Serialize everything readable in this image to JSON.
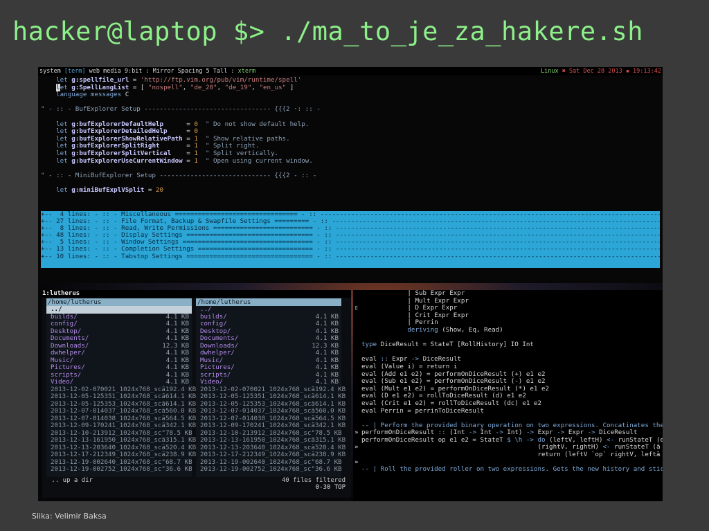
{
  "slide": {
    "title": "hacker@laptop $> ./ma_to_je_za_hakere.sh",
    "caption": "Slika: Velimir Baksa"
  },
  "statusbar": {
    "left_prefix": "system ",
    "left_tag": "[term]",
    "left_rest": " web media 9:bit : Mirror Spacing 5 Tall : ",
    "left_app": "xterm",
    "right_os": "Linux",
    "right_date": " ✖ Sat Dec 28 2013 ▪ 19:13:42"
  },
  "vim": {
    "lines": [
      [
        {
          "t": "    "
        },
        {
          "t": "let ",
          "c": "kw"
        },
        {
          "t": "g:spellfile_url",
          "c": "var"
        },
        {
          "t": " = "
        },
        {
          "t": "'http://ftp.vim.org/pub/vim/runtime/spell'",
          "c": "str"
        }
      ],
      [
        {
          "t": "    "
        },
        {
          "t": "l",
          "c": "cursor"
        },
        {
          "t": "et ",
          "c": "kw"
        },
        {
          "t": "g:SpellLangList",
          "c": "var"
        },
        {
          "t": " = [ "
        },
        {
          "t": "\"nospell\"",
          "c": "str"
        },
        {
          "t": ", "
        },
        {
          "t": "\"de_20\"",
          "c": "str"
        },
        {
          "t": ", "
        },
        {
          "t": "\"de_19\"",
          "c": "str"
        },
        {
          "t": ", "
        },
        {
          "t": "\"en_us\"",
          "c": "str"
        },
        {
          "t": " ]"
        }
      ],
      [
        {
          "t": "    "
        },
        {
          "t": "language messages ",
          "c": "kw"
        },
        {
          "t": "C"
        }
      ],
      [
        {
          "t": ""
        }
      ],
      [
        {
          "t": "\" - :: - BufExplorer Setup --------------------------------- {{{2 ·: :: -",
          "c": "cmt"
        }
      ],
      [
        {
          "t": ""
        }
      ],
      [
        {
          "t": "    "
        },
        {
          "t": "let ",
          "c": "kw"
        },
        {
          "t": "g:bufExplorerDefaultHelp",
          "c": "var"
        },
        {
          "t": "      = "
        },
        {
          "t": "0",
          "c": "num"
        },
        {
          "t": "  \" Do not show default help.",
          "c": "cmt"
        }
      ],
      [
        {
          "t": "    "
        },
        {
          "t": "let ",
          "c": "kw"
        },
        {
          "t": "g:bufExplorerDetailedHelp",
          "c": "var"
        },
        {
          "t": "     = "
        },
        {
          "t": "0",
          "c": "num"
        }
      ],
      [
        {
          "t": "    "
        },
        {
          "t": "let ",
          "c": "kw"
        },
        {
          "t": "g:bufExplorerShowRelativePath",
          "c": "var"
        },
        {
          "t": " = "
        },
        {
          "t": "1",
          "c": "num"
        },
        {
          "t": "  \" Show relative paths.",
          "c": "cmt"
        }
      ],
      [
        {
          "t": "    "
        },
        {
          "t": "let ",
          "c": "kw"
        },
        {
          "t": "g:bufExplorerSplitRight",
          "c": "var"
        },
        {
          "t": "       = "
        },
        {
          "t": "1",
          "c": "num"
        },
        {
          "t": "  \" Split right.",
          "c": "cmt"
        }
      ],
      [
        {
          "t": "    "
        },
        {
          "t": "let ",
          "c": "kw"
        },
        {
          "t": "g:bufExplorerSplitVertical",
          "c": "var"
        },
        {
          "t": "    = "
        },
        {
          "t": "1",
          "c": "num"
        },
        {
          "t": "  \" Split vertically.",
          "c": "cmt"
        }
      ],
      [
        {
          "t": "    "
        },
        {
          "t": "let ",
          "c": "kw"
        },
        {
          "t": "g:bufExplorerUseCurrentWindow",
          "c": "var"
        },
        {
          "t": " = "
        },
        {
          "t": "1",
          "c": "num"
        },
        {
          "t": "  \" Open using current window.",
          "c": "cmt"
        }
      ],
      [
        {
          "t": ""
        }
      ],
      [
        {
          "t": "\" - :: - MiniBufExplorer Setup ----------------------------- {{{2 - :: -",
          "c": "cmt"
        }
      ],
      [
        {
          "t": ""
        }
      ],
      [
        {
          "t": "    "
        },
        {
          "t": "let ",
          "c": "kw"
        },
        {
          "t": "g:miniBufExplVSplit",
          "c": "var"
        },
        {
          "t": " = "
        },
        {
          "t": "20",
          "c": "num"
        }
      ]
    ],
    "folds": [
      "+--  4 lines: - :: - Miscellaneous ================================ - :: -----------------------------------------------------------------------------------------",
      "+-- 27 lines: - :: - File Format, Backup & Swapfile Settings ========= - :: -----------------------------------------------------------------------------------------",
      "+--  8 lines: - :: - Read, Write Permissions ========================== - :: -----------------------------------------------------------------------------------------",
      "+-- 48 lines: - :: - Display Settings ================================= - :: -----------------------------------------------------------------------------------------",
      "+--  5 lines: - :: - Window Settings ================================== - :: -----------------------------------------------------------------------------------------",
      "+-- 13 lines: - :: - Completion Settings ============================== - :: -----------------------------------------------------------------------------------------",
      "+-- 10 lines: - :: - Tabstop Settings ================================= - :: -----------------------------------------------------------------------------------------"
    ]
  },
  "filemanager": {
    "tab_label": "1:lutherus",
    "footer_left": " .. up a dir",
    "footer_right": "40 files filtered",
    "footer_pos": "0-30 TOP",
    "columns": [
      {
        "path": "/home/lutherus",
        "rows": [
          {
            "name": "../",
            "size": "",
            "kind": "sel"
          },
          {
            "name": "builds/",
            "size": "4.1 KB",
            "kind": "dir"
          },
          {
            "name": "config/",
            "size": "4.1 KB",
            "kind": "dir"
          },
          {
            "name": "Desktop/",
            "size": "4.1 KB",
            "kind": "dir"
          },
          {
            "name": "Documents/",
            "size": "4.1 KB",
            "kind": "dir"
          },
          {
            "name": "Downloads/",
            "size": "12.3 KB",
            "kind": "dir"
          },
          {
            "name": "dwhelper/",
            "size": "4.1 KB",
            "kind": "dir"
          },
          {
            "name": "Music/",
            "size": "4.1 KB",
            "kind": "dir"
          },
          {
            "name": "Pictures/",
            "size": "4.1 KB",
            "kind": "dir"
          },
          {
            "name": "scripts/",
            "size": "4.1 KB",
            "kind": "dir"
          },
          {
            "name": "Video/",
            "size": "4.1 KB",
            "kind": "dir"
          },
          {
            "name": "2013-12-02-070021_1024x768_scä",
            "size": "192.4 KB",
            "kind": "file"
          },
          {
            "name": "2013-12-05-125351_1024x768_scä",
            "size": "614.1 KB",
            "kind": "file"
          },
          {
            "name": "2013-12-05-125353_1024x768_scä",
            "size": "614.1 KB",
            "kind": "file"
          },
          {
            "name": "2013-12-07-014037_1024x768_scä",
            "size": "560.0 KB",
            "kind": "file"
          },
          {
            "name": "2013-12-07-014038_1024x768_scä",
            "size": "564.5 KB",
            "kind": "file"
          },
          {
            "name": "2013-12-09-170241_1024x768_scä",
            "size": "342.1 KB",
            "kind": "file"
          },
          {
            "name": "2013-12-10-213912_1024x768_sc\"",
            "size": "78.5 KB",
            "kind": "file"
          },
          {
            "name": "2013-12-13-161950_1024x768_scä",
            "size": "315.1 KB",
            "kind": "file"
          },
          {
            "name": "2013-12-13-203640_1024x768_scä",
            "size": "520.4 KB",
            "kind": "file"
          },
          {
            "name": "2013-12-17-212349_1024x768_scä",
            "size": "238.9 KB",
            "kind": "file"
          },
          {
            "name": "2013-12-19-002640_1024x768_sc\"",
            "size": "68.7 KB",
            "kind": "file"
          },
          {
            "name": "2013-12-19-002752_1024x768_sc\"",
            "size": "36.6 KB",
            "kind": "file"
          }
        ]
      },
      {
        "path": "/home/lutherus",
        "rows": [
          {
            "name": "../",
            "size": "",
            "kind": "dir"
          },
          {
            "name": "builds/",
            "size": "4.1 KB",
            "kind": "dir"
          },
          {
            "name": "config/",
            "size": "4.1 KB",
            "kind": "dir"
          },
          {
            "name": "Desktop/",
            "size": "4.1 KB",
            "kind": "dir"
          },
          {
            "name": "Documents/",
            "size": "4.1 KB",
            "kind": "dir"
          },
          {
            "name": "Downloads/",
            "size": "12.3 KB",
            "kind": "dir"
          },
          {
            "name": "dwhelper/",
            "size": "4.1 KB",
            "kind": "dir"
          },
          {
            "name": "Music/",
            "size": "4.1 KB",
            "kind": "dir"
          },
          {
            "name": "Pictures/",
            "size": "4.1 KB",
            "kind": "dir"
          },
          {
            "name": "scripts/",
            "size": "4.1 KB",
            "kind": "dir"
          },
          {
            "name": "Video/",
            "size": "4.1 KB",
            "kind": "dir"
          },
          {
            "name": "2013-12-02-070021_1024x768_scä",
            "size": "192.4 KB",
            "kind": "file"
          },
          {
            "name": "2013-12-05-125351_1024x768_scä",
            "size": "614.1 KB",
            "kind": "file"
          },
          {
            "name": "2013-12-05-125353_1024x768_scä",
            "size": "614.1 KB",
            "kind": "file"
          },
          {
            "name": "2013-12-07-014037_1024x768_scä",
            "size": "560.0 KB",
            "kind": "file"
          },
          {
            "name": "2013-12-07-014038_1024x768_scä",
            "size": "564.5 KB",
            "kind": "file"
          },
          {
            "name": "2013-12-09-170241_1024x768_scä",
            "size": "342.1 KB",
            "kind": "file"
          },
          {
            "name": "2013-12-10-213912_1024x768_sc\"",
            "size": "78.5 KB",
            "kind": "file"
          },
          {
            "name": "2013-12-13-161950_1024x768_scä",
            "size": "315.1 KB",
            "kind": "file"
          },
          {
            "name": "2013-12-13-203640_1024x768_scä",
            "size": "520.4 KB",
            "kind": "file"
          },
          {
            "name": "2013-12-17-212349_1024x768_scä",
            "size": "238.9 KB",
            "kind": "file"
          },
          {
            "name": "2013-12-19-002640_1024x768_sc\"",
            "size": "68.7 KB",
            "kind": "file"
          },
          {
            "name": "2013-12-19-002752_1024x768_sc\"",
            "size": "36.6 KB",
            "kind": "file"
          }
        ]
      }
    ]
  },
  "haskell": {
    "lines": [
      {
        "p": "",
        "segs": [
          {
            "t": "            | Sub Expr Expr"
          }
        ]
      },
      {
        "p": "",
        "segs": [
          {
            "t": "            | Mult Expr Expr"
          }
        ]
      },
      {
        "p": "▯",
        "segs": [
          {
            "t": "            | D Expr Expr"
          }
        ]
      },
      {
        "p": "",
        "segs": [
          {
            "t": "            | Crit Expr Expr"
          }
        ]
      },
      {
        "p": "",
        "segs": [
          {
            "t": "            | Perrin"
          }
        ]
      },
      {
        "p": "",
        "segs": [
          {
            "t": "            "
          },
          {
            "t": "deriving",
            "c": "hk"
          },
          {
            "t": " (Show, Eq, Read)"
          }
        ]
      },
      {
        "p": "",
        "segs": [
          {
            "t": ""
          }
        ]
      },
      {
        "p": "",
        "segs": [
          {
            "t": "type",
            "c": "hk"
          },
          {
            "t": " DiceResult = StateT [RollHistory] IO Int"
          }
        ]
      },
      {
        "p": "",
        "segs": [
          {
            "t": ""
          }
        ]
      },
      {
        "p": "",
        "segs": [
          {
            "t": "eval "
          },
          {
            "t": "::",
            "c": "hk"
          },
          {
            "t": " Expr "
          },
          {
            "t": "->",
            "c": "hk"
          },
          {
            "t": " DiceResult"
          }
        ]
      },
      {
        "p": "",
        "segs": [
          {
            "t": "eval (Value i) = return i"
          }
        ]
      },
      {
        "p": "",
        "segs": [
          {
            "t": "eval (Add e1 e2) = performOnDiceResult (+) e1 e2"
          }
        ]
      },
      {
        "p": "",
        "segs": [
          {
            "t": "eval (Sub e1 e2) = performOnDiceResult (-) e1 e2"
          }
        ]
      },
      {
        "p": "",
        "segs": [
          {
            "t": "eval (Mult e1 e2) = performOnDiceResult (*) e1 e2"
          }
        ]
      },
      {
        "p": "",
        "segs": [
          {
            "t": "eval (D e1 e2) = rollToDiceResult (d) e1 e2"
          }
        ]
      },
      {
        "p": "",
        "segs": [
          {
            "t": "eval (Crit e1 e2) = rollToDiceResult (dc) e1 e2"
          }
        ]
      },
      {
        "p": "",
        "segs": [
          {
            "t": "eval Perrin = perrinToDiceResult"
          }
        ]
      },
      {
        "p": "",
        "segs": [
          {
            "t": ""
          }
        ]
      },
      {
        "p": "",
        "segs": [
          {
            "t": "-- | Perform the provided binary operation on two expressions. Concatinates theiñ",
            "c": "hcmt"
          }
        ]
      },
      {
        "p": "»",
        "segs": [
          {
            "t": "performOnDiceResult "
          },
          {
            "t": "::",
            "c": "hk"
          },
          {
            "t": " (Int "
          },
          {
            "t": "->",
            "c": "hk"
          },
          {
            "t": " Int "
          },
          {
            "t": "->",
            "c": "hk"
          },
          {
            "t": " Int) "
          },
          {
            "t": "->",
            "c": "hk"
          },
          {
            "t": " Expr "
          },
          {
            "t": "->",
            "c": "hk"
          },
          {
            "t": " Expr "
          },
          {
            "t": "->",
            "c": "hk"
          },
          {
            "t": " DiceResult"
          }
        ]
      },
      {
        "p": "",
        "segs": [
          {
            "t": "performOnDiceResult op e1 e2 = StateT "
          },
          {
            "t": "$ \\h -> do",
            "c": "hk"
          },
          {
            "t": " (leftV, leftH) "
          },
          {
            "t": "<-",
            "c": "hk"
          },
          {
            "t": " runStateT (evä"
          }
        ]
      },
      {
        "p": "»",
        "segs": [
          {
            "t": "                                              (rightV, rightH) "
          },
          {
            "t": "<-",
            "c": "hk"
          },
          {
            "t": " runStateT (ä"
          }
        ]
      },
      {
        "p": "",
        "segs": [
          {
            "t": "                                              return (leftV `op` rightV, leftä"
          }
        ]
      },
      {
        "p": "»",
        "segs": [
          {
            "t": ""
          }
        ]
      },
      {
        "p": "",
        "segs": [
          {
            "t": "-- | Roll the provided roller on two expressions. Gets the new history and stickä",
            "c": "hcmt"
          }
        ]
      }
    ]
  }
}
